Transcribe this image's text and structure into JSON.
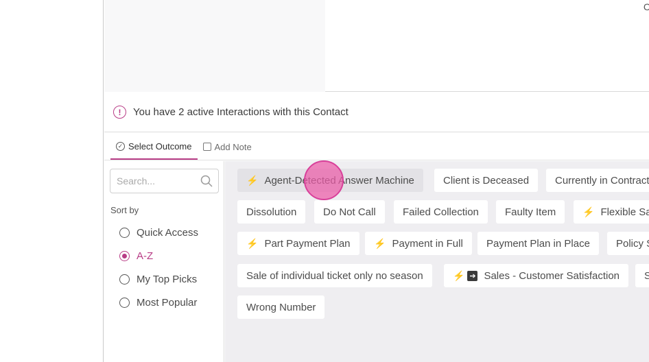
{
  "corner_glyph": "C",
  "banner": {
    "text": "You have 2 active Interactions with this Contact",
    "icon": "alert-circle-icon"
  },
  "tabs": [
    {
      "label": "Select Outcome",
      "icon": "check-circle-icon",
      "active": true
    },
    {
      "label": "Add Note",
      "icon": "note-icon",
      "active": false
    }
  ],
  "search": {
    "placeholder": "Search...",
    "value": ""
  },
  "sort": {
    "label": "Sort by",
    "options": [
      "Quick Access",
      "A-Z",
      "My Top Picks",
      "Most Popular"
    ],
    "selected": "A-Z"
  },
  "outcomes": [
    {
      "label": "Agent-Detected Answer Machine",
      "icons": [
        "bolt-icon"
      ]
    },
    {
      "label": "Client is Deceased",
      "icons": []
    },
    {
      "label": "Currently in Contract",
      "icons": []
    },
    {
      "label": "Dissolution",
      "icons": []
    },
    {
      "label": "Do Not Call",
      "icons": []
    },
    {
      "label": "Failed Collection",
      "icons": []
    },
    {
      "label": "Faulty Item",
      "icons": []
    },
    {
      "label": "Flexible Sa",
      "icons": [
        "bolt-icon"
      ]
    },
    {
      "label": "Part Payment Plan",
      "icons": [
        "bolt-icon"
      ]
    },
    {
      "label": "Payment in Full",
      "icons": [
        "bolt-icon"
      ]
    },
    {
      "label": "Payment Plan in Place",
      "icons": []
    },
    {
      "label": "Policy S",
      "icons": []
    },
    {
      "label": "Sale of individual ticket only no season",
      "icons": []
    },
    {
      "label": "Sales - Customer Satisfaction",
      "icons": [
        "bolt-icon",
        "arrow-box-icon"
      ]
    },
    {
      "label": "S",
      "icons": []
    },
    {
      "label": "Wrong Number",
      "icons": []
    }
  ],
  "accent_color": "#b83c86"
}
